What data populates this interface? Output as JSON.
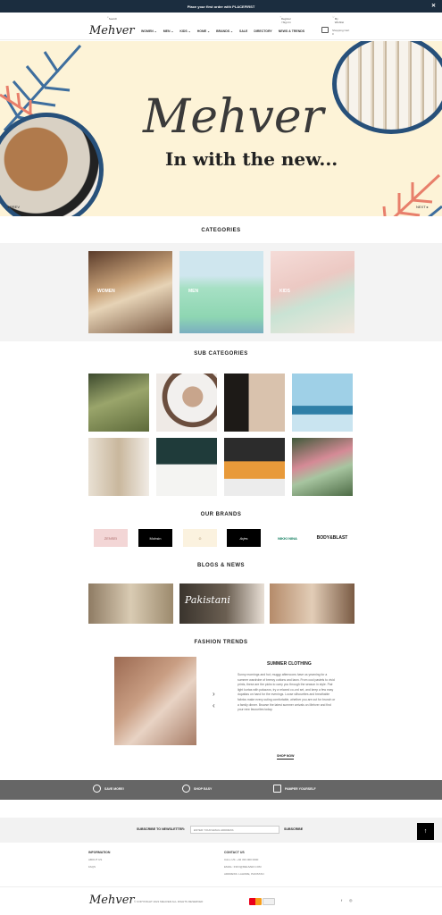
{
  "topbar": {
    "promo": "Place your first order with",
    "code": "PLACEFIRST",
    "close": "✕"
  },
  "util": {
    "search": "Search",
    "account": "Register / Sign In",
    "wishlist": "My Wishlist"
  },
  "nav": {
    "logo": "Mehver",
    "menu": [
      "WOMEN ⌄",
      "MEN ⌄",
      "KIDS ⌄",
      "HOME ⌄",
      "BRANDS ⌄",
      "SALE",
      "DIRECTORY",
      "NEWS & TRENDS"
    ],
    "cart_label": "Shopping Cart",
    "cart_count": "0"
  },
  "hero": {
    "logo": "Mehver",
    "tagline": "In with the new...",
    "prev": "◂ PREV",
    "next": "NEXT ▸"
  },
  "categories": {
    "title": "CATEGORIES",
    "items": [
      {
        "label": "WOMEN"
      },
      {
        "label": "MEN"
      },
      {
        "label": "KIDS"
      }
    ]
  },
  "subcategories": {
    "title": "SUB CATEGORIES"
  },
  "brands": {
    "title": "OUR BRANDS",
    "items": [
      "ZENSEI",
      "Mohsin",
      "",
      "Arjes",
      "NIKKI NINA",
      "BODY&BLAST"
    ]
  },
  "blogs": {
    "title": "BLOGS & NEWS",
    "overlay": "Pakistani"
  },
  "trends": {
    "title": "FASHION TRENDS",
    "card_title": "SUMMER CLOTHING",
    "text": "Sunny mornings and hot, muggy afternoons have us yearning for a summer wardrobe of breezy cottons and lawn. From cool pastels to vivid prints, these are the picks to carry you through the season in style. Pair light kurtas with palazzos, try a relaxed co-ord set, and keep a few easy dupattas on hand for the evenings. Loose silhouettes and breathable fabrics make every outing comfortable, whether you are out for brunch or a family dinner. Browse the latest summer arrivals on Mehver and find your new favourites today.",
    "shop": "SHOP NOW"
  },
  "features": [
    {
      "label": "SAVE MORE!"
    },
    {
      "label": "SHOP EASY"
    },
    {
      "label": "PAMPER YOURSELF"
    }
  ],
  "newsletter": {
    "label": "SUBSCRIBE TO NEWSLETTER:",
    "placeholder": "ENTER YOUR EMAIL ADDRESS",
    "button": "SUBSCRIBE"
  },
  "footer": {
    "info_title": "INFORMATION",
    "info_links": [
      "ABOUT US",
      "FAQS"
    ],
    "contact_title": "CONTACT US",
    "contact": [
      "CALL US: +92 333 000 0000",
      "EMAIL: INFO@MEHVER.COM",
      "ADDRESS: LAHORE, PAKISTAN"
    ]
  },
  "bottom": {
    "logo": "Mehver",
    "copyright": "© COPYRIGHT 2021 MEHVER ALL RIGHTS RESERVED",
    "social": [
      "f",
      "◎"
    ]
  }
}
